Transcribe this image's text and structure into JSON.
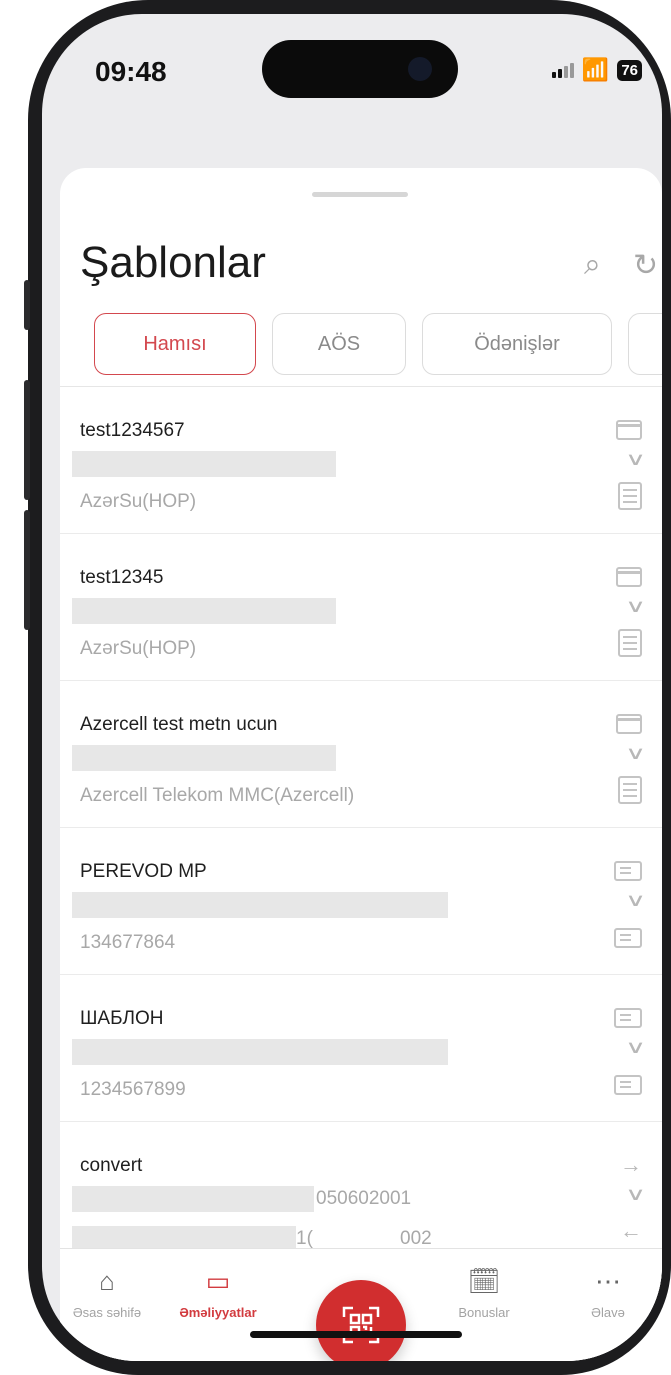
{
  "status": {
    "time": "09:48",
    "battery": "76"
  },
  "header": {
    "title": "Şablonlar"
  },
  "tabs": [
    {
      "label": "Hamısı",
      "active": true
    },
    {
      "label": "AÖS",
      "active": false
    },
    {
      "label": "Ödənişlər",
      "active": false
    }
  ],
  "templates": [
    {
      "name": "test1234567",
      "subtitle": "AzərSu(HOP)"
    },
    {
      "name": "test12345",
      "subtitle": "AzərSu(HOP)"
    },
    {
      "name": "Azercell test metn ucun",
      "subtitle": "Azercell Telekom MMC(Azercell)"
    },
    {
      "name": "PEREVOD MP",
      "subtitle": "134677864"
    },
    {
      "name": "ШАБЛОН",
      "subtitle": "1234567899"
    },
    {
      "name": "convert",
      "line1_tail": "050602001",
      "line2_tail_a": "1(",
      "line2_tail_b": "002"
    }
  ],
  "tabbar": {
    "items": [
      {
        "label": "Əsas səhifə",
        "icon": "home-icon"
      },
      {
        "label": "Əməliyyatlar",
        "icon": "wallet-icon",
        "active": true
      },
      {
        "label": "Bonuslar",
        "icon": "gift-icon"
      },
      {
        "label": "Əlavə",
        "icon": "more-icon"
      }
    ],
    "fab_icon": "qr-scan-icon"
  },
  "colors": {
    "accent": "#d3484e",
    "fab": "#d12e2f"
  }
}
